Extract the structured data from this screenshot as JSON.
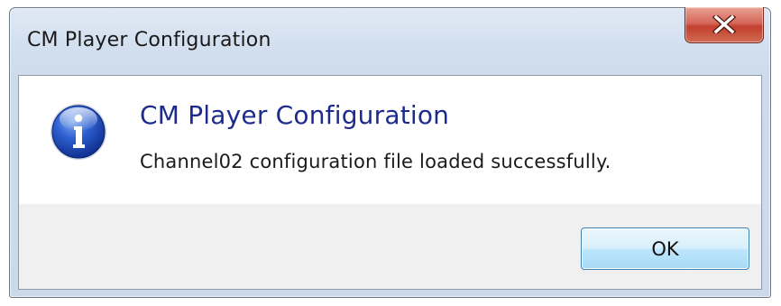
{
  "window": {
    "title": "CM Player Configuration",
    "close_icon": "close-icon"
  },
  "dialog": {
    "icon": "information-icon",
    "main_instruction": "CM Player Configuration",
    "message": "Channel02 configuration file loaded successfully.",
    "ok_label": "OK"
  },
  "colors": {
    "main_instruction": "#1d2b8f",
    "icon_blue": "#1e46b4",
    "close_red": "#c2402f",
    "ok_border": "#3c7fb1"
  }
}
